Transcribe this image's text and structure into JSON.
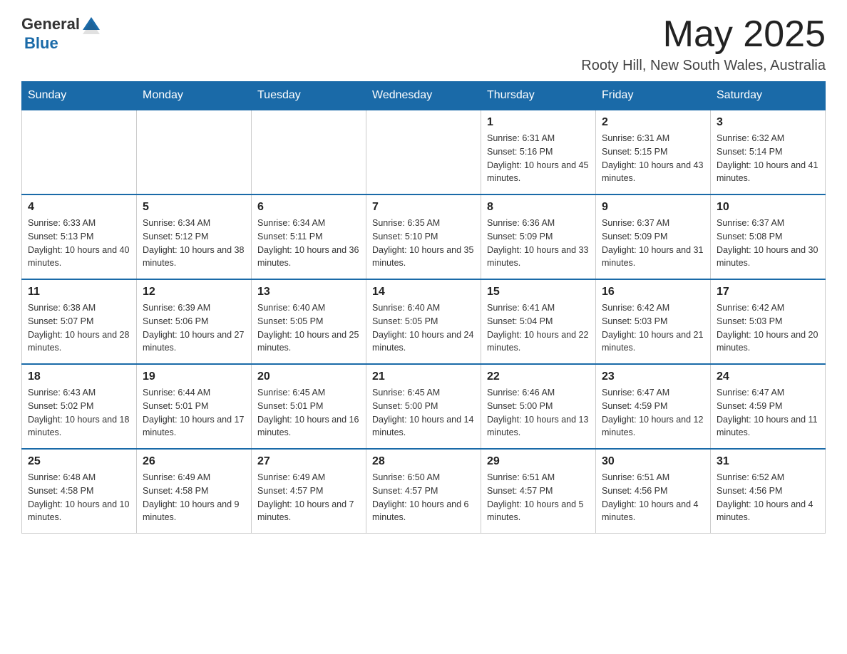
{
  "header": {
    "logo": {
      "text_general": "General",
      "logo_symbol": "▶",
      "text_blue": "Blue"
    },
    "month_title": "May 2025",
    "location": "Rooty Hill, New South Wales, Australia"
  },
  "weekdays": [
    "Sunday",
    "Monday",
    "Tuesday",
    "Wednesday",
    "Thursday",
    "Friday",
    "Saturday"
  ],
  "weeks": [
    [
      {
        "day": "",
        "sunrise": "",
        "sunset": "",
        "daylight": ""
      },
      {
        "day": "",
        "sunrise": "",
        "sunset": "",
        "daylight": ""
      },
      {
        "day": "",
        "sunrise": "",
        "sunset": "",
        "daylight": ""
      },
      {
        "day": "",
        "sunrise": "",
        "sunset": "",
        "daylight": ""
      },
      {
        "day": "1",
        "sunrise": "Sunrise: 6:31 AM",
        "sunset": "Sunset: 5:16 PM",
        "daylight": "Daylight: 10 hours and 45 minutes."
      },
      {
        "day": "2",
        "sunrise": "Sunrise: 6:31 AM",
        "sunset": "Sunset: 5:15 PM",
        "daylight": "Daylight: 10 hours and 43 minutes."
      },
      {
        "day": "3",
        "sunrise": "Sunrise: 6:32 AM",
        "sunset": "Sunset: 5:14 PM",
        "daylight": "Daylight: 10 hours and 41 minutes."
      }
    ],
    [
      {
        "day": "4",
        "sunrise": "Sunrise: 6:33 AM",
        "sunset": "Sunset: 5:13 PM",
        "daylight": "Daylight: 10 hours and 40 minutes."
      },
      {
        "day": "5",
        "sunrise": "Sunrise: 6:34 AM",
        "sunset": "Sunset: 5:12 PM",
        "daylight": "Daylight: 10 hours and 38 minutes."
      },
      {
        "day": "6",
        "sunrise": "Sunrise: 6:34 AM",
        "sunset": "Sunset: 5:11 PM",
        "daylight": "Daylight: 10 hours and 36 minutes."
      },
      {
        "day": "7",
        "sunrise": "Sunrise: 6:35 AM",
        "sunset": "Sunset: 5:10 PM",
        "daylight": "Daylight: 10 hours and 35 minutes."
      },
      {
        "day": "8",
        "sunrise": "Sunrise: 6:36 AM",
        "sunset": "Sunset: 5:09 PM",
        "daylight": "Daylight: 10 hours and 33 minutes."
      },
      {
        "day": "9",
        "sunrise": "Sunrise: 6:37 AM",
        "sunset": "Sunset: 5:09 PM",
        "daylight": "Daylight: 10 hours and 31 minutes."
      },
      {
        "day": "10",
        "sunrise": "Sunrise: 6:37 AM",
        "sunset": "Sunset: 5:08 PM",
        "daylight": "Daylight: 10 hours and 30 minutes."
      }
    ],
    [
      {
        "day": "11",
        "sunrise": "Sunrise: 6:38 AM",
        "sunset": "Sunset: 5:07 PM",
        "daylight": "Daylight: 10 hours and 28 minutes."
      },
      {
        "day": "12",
        "sunrise": "Sunrise: 6:39 AM",
        "sunset": "Sunset: 5:06 PM",
        "daylight": "Daylight: 10 hours and 27 minutes."
      },
      {
        "day": "13",
        "sunrise": "Sunrise: 6:40 AM",
        "sunset": "Sunset: 5:05 PM",
        "daylight": "Daylight: 10 hours and 25 minutes."
      },
      {
        "day": "14",
        "sunrise": "Sunrise: 6:40 AM",
        "sunset": "Sunset: 5:05 PM",
        "daylight": "Daylight: 10 hours and 24 minutes."
      },
      {
        "day": "15",
        "sunrise": "Sunrise: 6:41 AM",
        "sunset": "Sunset: 5:04 PM",
        "daylight": "Daylight: 10 hours and 22 minutes."
      },
      {
        "day": "16",
        "sunrise": "Sunrise: 6:42 AM",
        "sunset": "Sunset: 5:03 PM",
        "daylight": "Daylight: 10 hours and 21 minutes."
      },
      {
        "day": "17",
        "sunrise": "Sunrise: 6:42 AM",
        "sunset": "Sunset: 5:03 PM",
        "daylight": "Daylight: 10 hours and 20 minutes."
      }
    ],
    [
      {
        "day": "18",
        "sunrise": "Sunrise: 6:43 AM",
        "sunset": "Sunset: 5:02 PM",
        "daylight": "Daylight: 10 hours and 18 minutes."
      },
      {
        "day": "19",
        "sunrise": "Sunrise: 6:44 AM",
        "sunset": "Sunset: 5:01 PM",
        "daylight": "Daylight: 10 hours and 17 minutes."
      },
      {
        "day": "20",
        "sunrise": "Sunrise: 6:45 AM",
        "sunset": "Sunset: 5:01 PM",
        "daylight": "Daylight: 10 hours and 16 minutes."
      },
      {
        "day": "21",
        "sunrise": "Sunrise: 6:45 AM",
        "sunset": "Sunset: 5:00 PM",
        "daylight": "Daylight: 10 hours and 14 minutes."
      },
      {
        "day": "22",
        "sunrise": "Sunrise: 6:46 AM",
        "sunset": "Sunset: 5:00 PM",
        "daylight": "Daylight: 10 hours and 13 minutes."
      },
      {
        "day": "23",
        "sunrise": "Sunrise: 6:47 AM",
        "sunset": "Sunset: 4:59 PM",
        "daylight": "Daylight: 10 hours and 12 minutes."
      },
      {
        "day": "24",
        "sunrise": "Sunrise: 6:47 AM",
        "sunset": "Sunset: 4:59 PM",
        "daylight": "Daylight: 10 hours and 11 minutes."
      }
    ],
    [
      {
        "day": "25",
        "sunrise": "Sunrise: 6:48 AM",
        "sunset": "Sunset: 4:58 PM",
        "daylight": "Daylight: 10 hours and 10 minutes."
      },
      {
        "day": "26",
        "sunrise": "Sunrise: 6:49 AM",
        "sunset": "Sunset: 4:58 PM",
        "daylight": "Daylight: 10 hours and 9 minutes."
      },
      {
        "day": "27",
        "sunrise": "Sunrise: 6:49 AM",
        "sunset": "Sunset: 4:57 PM",
        "daylight": "Daylight: 10 hours and 7 minutes."
      },
      {
        "day": "28",
        "sunrise": "Sunrise: 6:50 AM",
        "sunset": "Sunset: 4:57 PM",
        "daylight": "Daylight: 10 hours and 6 minutes."
      },
      {
        "day": "29",
        "sunrise": "Sunrise: 6:51 AM",
        "sunset": "Sunset: 4:57 PM",
        "daylight": "Daylight: 10 hours and 5 minutes."
      },
      {
        "day": "30",
        "sunrise": "Sunrise: 6:51 AM",
        "sunset": "Sunset: 4:56 PM",
        "daylight": "Daylight: 10 hours and 4 minutes."
      },
      {
        "day": "31",
        "sunrise": "Sunrise: 6:52 AM",
        "sunset": "Sunset: 4:56 PM",
        "daylight": "Daylight: 10 hours and 4 minutes."
      }
    ]
  ]
}
